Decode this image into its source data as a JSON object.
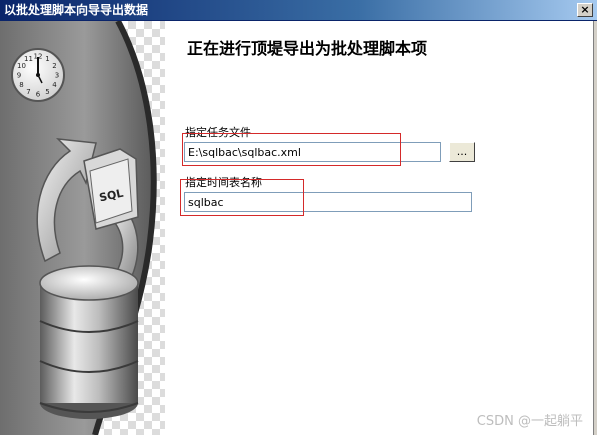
{
  "window": {
    "title": "以批处理脚本向导导出数据",
    "close_glyph": "×"
  },
  "wizard": {
    "heading": "正在进行顶堤导出为批处理脚本项",
    "task_file": {
      "label": "指定任务文件",
      "value": "E:\\sqlbac\\sqlbac.xml",
      "browse_label": "..."
    },
    "schedule": {
      "label": "指定时间表名称",
      "value": "sqlbac"
    }
  },
  "graphic": {
    "badge_text": "SQL",
    "clock_numerals": [
      "12",
      "1",
      "2",
      "3",
      "4",
      "5",
      "6",
      "7",
      "8",
      "9",
      "10",
      "11"
    ]
  },
  "watermark": "CSDN @一起躺平",
  "colors": {
    "title_start": "#0a246a",
    "title_end": "#a6caf0",
    "highlight": "#d42a2a"
  }
}
